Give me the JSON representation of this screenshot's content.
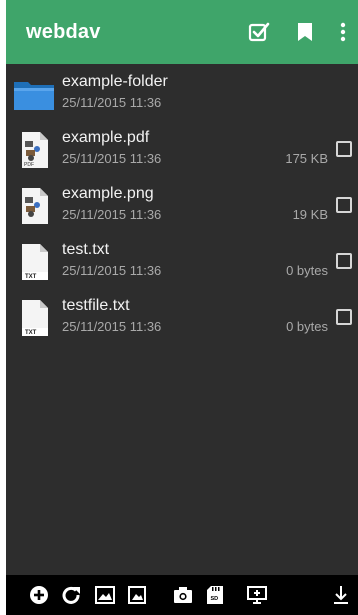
{
  "appbar": {
    "title": "webdav",
    "background": "#3fa56a",
    "actions": [
      "select-all-icon",
      "bookmark-icon",
      "more-vert-icon"
    ]
  },
  "files": [
    {
      "name": "example-folder",
      "date": "25/11/2015 11:36",
      "size": "",
      "icon": "folder-icon",
      "badge": "",
      "selectable": false
    },
    {
      "name": "example.pdf",
      "date": "25/11/2015 11:36",
      "size": "175 KB",
      "icon": "pdf-file-icon",
      "badge": "PDF",
      "selectable": true
    },
    {
      "name": "example.png",
      "date": "25/11/2015 11:36",
      "size": "19 KB",
      "icon": "image-file-icon",
      "badge": "",
      "selectable": true
    },
    {
      "name": "test.txt",
      "date": "25/11/2015 11:36",
      "size": "0 bytes",
      "icon": "text-file-icon",
      "badge": "TXT",
      "selectable": true
    },
    {
      "name": "testfile.txt",
      "date": "25/11/2015 11:36",
      "size": "0 bytes",
      "icon": "text-file-icon",
      "badge": "TXT",
      "selectable": true
    }
  ],
  "bottombar": {
    "icons": [
      "add-icon",
      "refresh-icon",
      "image-icon",
      "gallery-icon",
      "camera-icon",
      "sd-card-icon",
      "cast-screen-icon",
      "download-icon"
    ]
  }
}
